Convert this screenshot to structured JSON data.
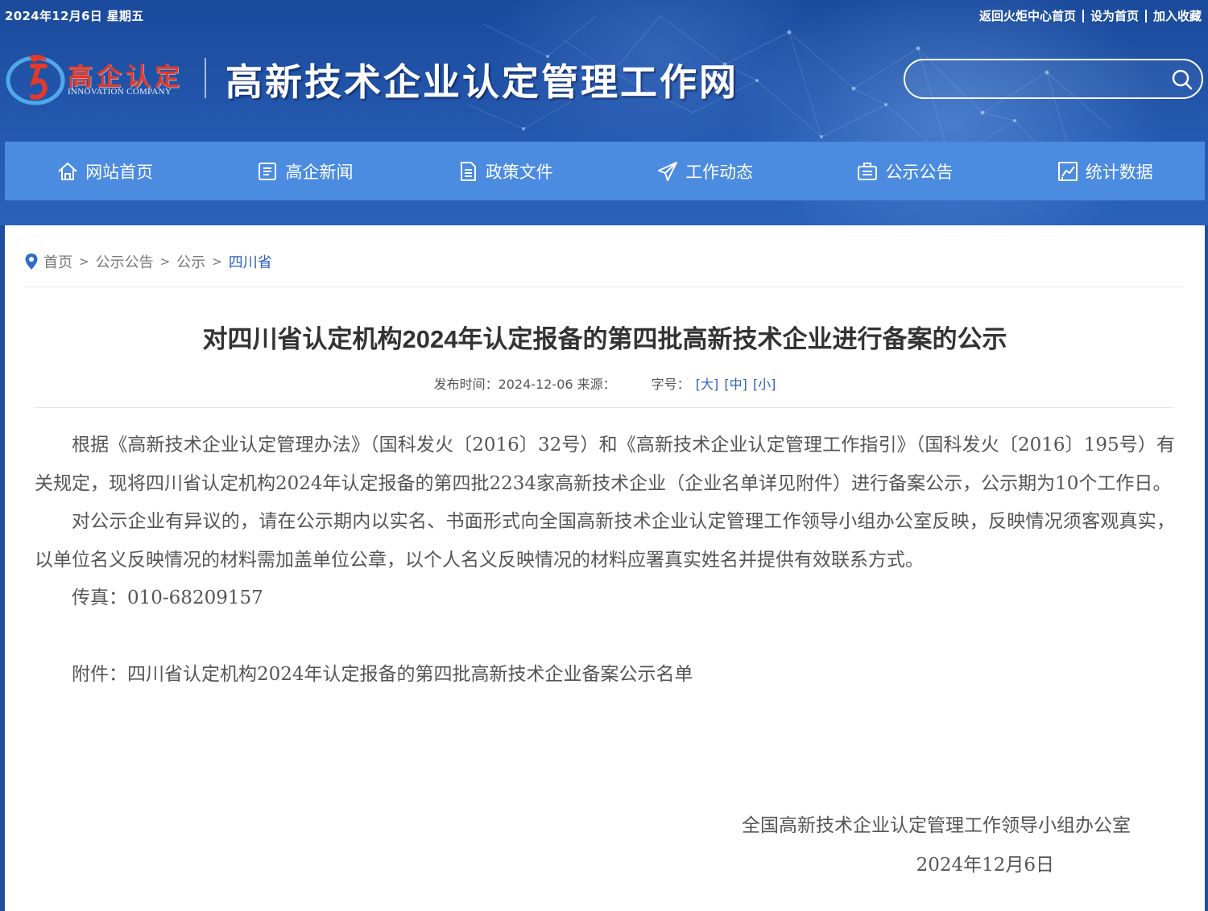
{
  "header": {
    "date": "2024年12月6日 星期五",
    "top_links": [
      "返回火炬中心首页",
      "设为首页",
      "加入收藏"
    ],
    "logo_cn": "高企认定",
    "logo_en": "INNOVATION COMPANY",
    "site_title": "高新技术企业认定管理工作网",
    "search_placeholder": ""
  },
  "nav": [
    {
      "label": "网站首页",
      "icon": "home-icon"
    },
    {
      "label": "高企新闻",
      "icon": "news-icon"
    },
    {
      "label": "政策文件",
      "icon": "document-icon"
    },
    {
      "label": "工作动态",
      "icon": "paper-plane-icon"
    },
    {
      "label": "公示公告",
      "icon": "briefcase-icon"
    },
    {
      "label": "统计数据",
      "icon": "chart-icon"
    }
  ],
  "breadcrumb": {
    "items": [
      "首页",
      "公示公告",
      "公示",
      "四川省"
    ],
    "separator": ">"
  },
  "article": {
    "title": "对四川省认定机构2024年认定报备的第四批高新技术企业进行备案的公示",
    "publish_label": "发布时间：2024-12-06 来源：",
    "font_size_label": "字号：",
    "font_size_options": [
      "[大]",
      "[中]",
      "[小]"
    ],
    "paragraphs": [
      "根据《高新技术企业认定管理办法》（国科发火〔2016〕32号）和《高新技术企业认定管理工作指引》（国科发火〔2016〕195号）有关规定，现将四川省认定机构2024年认定报备的第四批2234家高新技术企业（企业名单详见附件）进行备案公示，公示期为10个工作日。",
      "对公示企业有异议的，请在公示期内以实名、书面形式向全国高新技术企业认定管理工作领导小组办公室反映，反映情况须客观真实，以单位名义反映情况的材料需加盖单位公章，以个人名义反映情况的材料应署真实姓名并提供有效联系方式。",
      "传真：010-68209157"
    ],
    "attachment": "附件：四川省认定机构2024年认定报备的第四批高新技术企业备案公示名单",
    "signature": "全国高新技术企业认定管理工作领导小组办公室",
    "sign_date": "2024年12月6日"
  },
  "colors": {
    "header_bg": "#1d4fa0",
    "nav_bg": "#4b8be0",
    "link_blue": "#2e5fbf",
    "logo_red": "#e13a2a"
  }
}
